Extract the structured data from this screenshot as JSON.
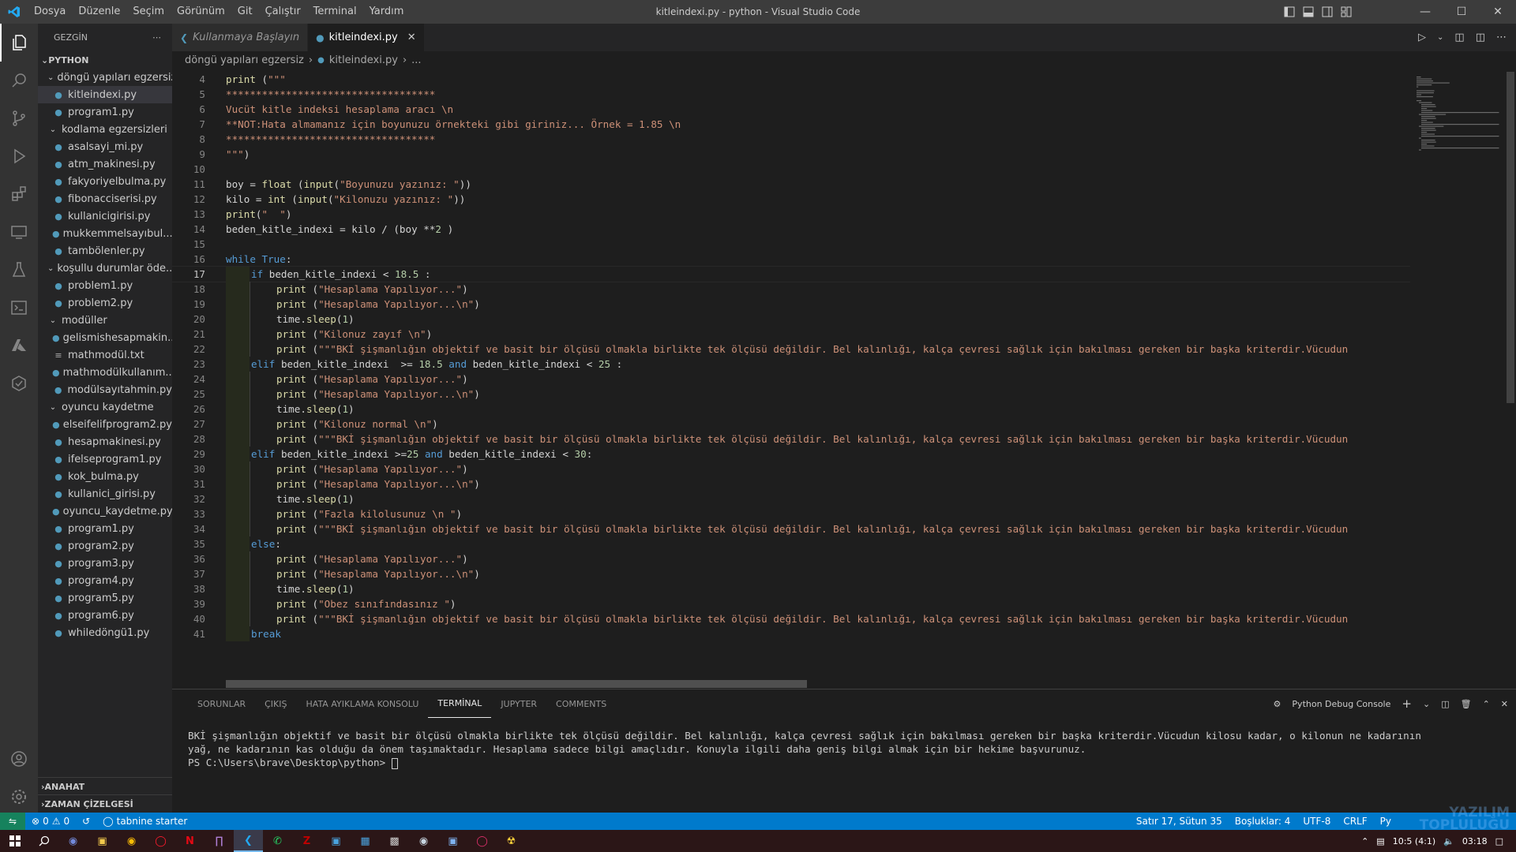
{
  "titlebar": {
    "menu": [
      "Dosya",
      "Düzenle",
      "Seçim",
      "Görünüm",
      "Git",
      "Çalıştır",
      "Terminal",
      "Yardım"
    ],
    "title": "kitleindexi.py - python - Visual Studio Code"
  },
  "sidebar": {
    "header": "GEZGİN",
    "root": "PYTHON",
    "tree": [
      {
        "type": "folder",
        "label": "döngü yapıları egzersiz",
        "depth": 1
      },
      {
        "type": "file",
        "label": "kitleindexi.py",
        "depth": 2,
        "selected": true
      },
      {
        "type": "file",
        "label": "program1.py",
        "depth": 2
      },
      {
        "type": "folder",
        "label": "kodlama egzersizleri",
        "depth": 1
      },
      {
        "type": "file",
        "label": "asalsayi_mi.py",
        "depth": 2
      },
      {
        "type": "file",
        "label": "atm_makinesi.py",
        "depth": 2
      },
      {
        "type": "file",
        "label": "fakyoriyelbulma.py",
        "depth": 2
      },
      {
        "type": "file",
        "label": "fibonacciserisi.py",
        "depth": 2
      },
      {
        "type": "file",
        "label": "kullanicigirisi.py",
        "depth": 2
      },
      {
        "type": "file",
        "label": "mukkemmelsayıbul...",
        "depth": 2
      },
      {
        "type": "file",
        "label": "tambölenler.py",
        "depth": 2
      },
      {
        "type": "folder",
        "label": "koşullu durumlar öde...",
        "depth": 1
      },
      {
        "type": "file",
        "label": "problem1.py",
        "depth": 2
      },
      {
        "type": "file",
        "label": "problem2.py",
        "depth": 2
      },
      {
        "type": "folder",
        "label": "modüller",
        "depth": 1
      },
      {
        "type": "file",
        "label": "gelismishesapmakin...",
        "depth": 2
      },
      {
        "type": "txt",
        "label": "mathmodül.txt",
        "depth": 2
      },
      {
        "type": "file",
        "label": "mathmodülkullanım....",
        "depth": 2
      },
      {
        "type": "file",
        "label": "modülsayıtahmin.py",
        "depth": 2
      },
      {
        "type": "folder",
        "label": "oyuncu kaydetme",
        "depth": 1
      },
      {
        "type": "file",
        "label": "elseifelifprogram2.py",
        "depth": 2
      },
      {
        "type": "file",
        "label": "hesapmakinesi.py",
        "depth": 2
      },
      {
        "type": "file",
        "label": "ifelseprogram1.py",
        "depth": 2
      },
      {
        "type": "file",
        "label": "kok_bulma.py",
        "depth": 2
      },
      {
        "type": "file",
        "label": "kullanici_girisi.py",
        "depth": 2
      },
      {
        "type": "file",
        "label": "oyuncu_kaydetme.py",
        "depth": 2
      },
      {
        "type": "file",
        "label": "program1.py",
        "depth": 2
      },
      {
        "type": "file",
        "label": "program2.py",
        "depth": 2
      },
      {
        "type": "file",
        "label": "program3.py",
        "depth": 2
      },
      {
        "type": "file",
        "label": "program4.py",
        "depth": 2
      },
      {
        "type": "file",
        "label": "program5.py",
        "depth": 2
      },
      {
        "type": "file",
        "label": "program6.py",
        "depth": 2
      },
      {
        "type": "file",
        "label": "whiledöngü1.py",
        "depth": 2
      }
    ],
    "outline": "ANAHAT",
    "timeline": "ZAMAN ÇİZELGESİ"
  },
  "tabs": [
    {
      "label": "Kullanmaya Başlayın",
      "active": false
    },
    {
      "label": "kitleindexi.py",
      "active": true
    }
  ],
  "breadcrumb": {
    "folder": "döngü yapıları egzersiz",
    "file": "kitleindexi.py",
    "tail": "..."
  },
  "code": {
    "current_line": 17,
    "lines": [
      {
        "n": 4,
        "indent": 0,
        "tokens": [
          [
            "fn",
            "print"
          ],
          [
            "op",
            " ("
          ],
          [
            "str",
            "\"\"\""
          ]
        ]
      },
      {
        "n": 5,
        "indent": 0,
        "tokens": [
          [
            "str",
            "***********************************"
          ]
        ]
      },
      {
        "n": 6,
        "indent": 0,
        "tokens": [
          [
            "str",
            "Vucüt kitle indeksi hesaplama aracı \\n"
          ]
        ]
      },
      {
        "n": 7,
        "indent": 0,
        "tokens": [
          [
            "str",
            "**NOT:Hata almamanız için boyunuzu örnekteki gibi giriniz... Örnek = 1.85 \\n"
          ]
        ]
      },
      {
        "n": 8,
        "indent": 0,
        "tokens": [
          [
            "str",
            "***********************************"
          ]
        ]
      },
      {
        "n": 9,
        "indent": 0,
        "tokens": [
          [
            "str",
            "\"\"\""
          ],
          [
            "op",
            ")"
          ]
        ]
      },
      {
        "n": 10,
        "indent": 0,
        "tokens": []
      },
      {
        "n": 11,
        "indent": 0,
        "tokens": [
          [
            "var",
            "boy"
          ],
          [
            "op",
            " = "
          ],
          [
            "fn",
            "float"
          ],
          [
            "op",
            " ("
          ],
          [
            "fn",
            "input"
          ],
          [
            "op",
            "("
          ],
          [
            "str",
            "\"Boyunuzu yazınız: \""
          ],
          [
            "op",
            "))"
          ]
        ]
      },
      {
        "n": 12,
        "indent": 0,
        "tokens": [
          [
            "var",
            "kilo"
          ],
          [
            "op",
            " = "
          ],
          [
            "fn",
            "int"
          ],
          [
            "op",
            " ("
          ],
          [
            "fn",
            "input"
          ],
          [
            "op",
            "("
          ],
          [
            "str",
            "\"Kilonuzu yazınız: \""
          ],
          [
            "op",
            "))"
          ]
        ]
      },
      {
        "n": 13,
        "indent": 0,
        "tokens": [
          [
            "fn",
            "print"
          ],
          [
            "op",
            "("
          ],
          [
            "str",
            "\"  \""
          ],
          [
            "op",
            ")"
          ]
        ]
      },
      {
        "n": 14,
        "indent": 0,
        "tokens": [
          [
            "var",
            "beden_kitle_indexi"
          ],
          [
            "op",
            " = "
          ],
          [
            "var",
            "kilo"
          ],
          [
            "op",
            " / ("
          ],
          [
            "var",
            "boy"
          ],
          [
            "op",
            " **"
          ],
          [
            "num",
            "2"
          ],
          [
            "op",
            " )"
          ]
        ]
      },
      {
        "n": 15,
        "indent": 0,
        "tokens": []
      },
      {
        "n": 16,
        "indent": 0,
        "tokens": [
          [
            "kw",
            "while"
          ],
          [
            "op",
            " "
          ],
          [
            "kw",
            "True"
          ],
          [
            "op",
            ":"
          ]
        ]
      },
      {
        "n": 17,
        "indent": 1,
        "tokens": [
          [
            "kw",
            "if"
          ],
          [
            "op",
            " "
          ],
          [
            "var",
            "beden_kitle_indexi"
          ],
          [
            "op",
            " < "
          ],
          [
            "num",
            "18.5"
          ],
          [
            "op",
            " :"
          ]
        ]
      },
      {
        "n": 18,
        "indent": 2,
        "tokens": [
          [
            "fn",
            "print"
          ],
          [
            "op",
            " ("
          ],
          [
            "str",
            "\"Hesaplama Yapılıyor...\""
          ],
          [
            "op",
            ")"
          ]
        ]
      },
      {
        "n": 19,
        "indent": 2,
        "tokens": [
          [
            "fn",
            "print"
          ],
          [
            "op",
            " ("
          ],
          [
            "str",
            "\"Hesaplama Yapılıyor...\\n\""
          ],
          [
            "op",
            ")"
          ]
        ]
      },
      {
        "n": 20,
        "indent": 2,
        "tokens": [
          [
            "var",
            "time"
          ],
          [
            "op",
            "."
          ],
          [
            "fn",
            "sleep"
          ],
          [
            "op",
            "("
          ],
          [
            "num",
            "1"
          ],
          [
            "op",
            ")"
          ]
        ]
      },
      {
        "n": 21,
        "indent": 2,
        "tokens": [
          [
            "fn",
            "print"
          ],
          [
            "op",
            " ("
          ],
          [
            "str",
            "\"Kilonuz zayıf \\n\""
          ],
          [
            "op",
            ")"
          ]
        ]
      },
      {
        "n": 22,
        "indent": 2,
        "tokens": [
          [
            "fn",
            "print"
          ],
          [
            "op",
            " ("
          ],
          [
            "str",
            "\"\"\"BKİ şişmanlığın objektif ve basit bir ölçüsü olmakla birlikte tek ölçüsü değildir. Bel kalınlığı, kalça çevresi sağlık için bakılması gereken bir başka kriterdir.Vücudun"
          ]
        ]
      },
      {
        "n": 23,
        "indent": 1,
        "tokens": [
          [
            "kw",
            "elif"
          ],
          [
            "op",
            " "
          ],
          [
            "var",
            "beden_kitle_indexi"
          ],
          [
            "op",
            "  >= "
          ],
          [
            "num",
            "18.5"
          ],
          [
            "op",
            " "
          ],
          [
            "kw",
            "and"
          ],
          [
            "op",
            " "
          ],
          [
            "var",
            "beden_kitle_indexi"
          ],
          [
            "op",
            " < "
          ],
          [
            "num",
            "25"
          ],
          [
            "op",
            " :"
          ]
        ]
      },
      {
        "n": 24,
        "indent": 2,
        "tokens": [
          [
            "fn",
            "print"
          ],
          [
            "op",
            " ("
          ],
          [
            "str",
            "\"Hesaplama Yapılıyor...\""
          ],
          [
            "op",
            ")"
          ]
        ]
      },
      {
        "n": 25,
        "indent": 2,
        "tokens": [
          [
            "fn",
            "print"
          ],
          [
            "op",
            " ("
          ],
          [
            "str",
            "\"Hesaplama Yapılıyor...\\n\""
          ],
          [
            "op",
            ")"
          ]
        ]
      },
      {
        "n": 26,
        "indent": 2,
        "tokens": [
          [
            "var",
            "time"
          ],
          [
            "op",
            "."
          ],
          [
            "fn",
            "sleep"
          ],
          [
            "op",
            "("
          ],
          [
            "num",
            "1"
          ],
          [
            "op",
            ")"
          ]
        ]
      },
      {
        "n": 27,
        "indent": 2,
        "tokens": [
          [
            "fn",
            "print"
          ],
          [
            "op",
            " ("
          ],
          [
            "str",
            "\"Kilonuz normal \\n\""
          ],
          [
            "op",
            ")"
          ]
        ]
      },
      {
        "n": 28,
        "indent": 2,
        "tokens": [
          [
            "fn",
            "print"
          ],
          [
            "op",
            " ("
          ],
          [
            "str",
            "\"\"\"BKİ şişmanlığın objektif ve basit bir ölçüsü olmakla birlikte tek ölçüsü değildir. Bel kalınlığı, kalça çevresi sağlık için bakılması gereken bir başka kriterdir.Vücudun"
          ]
        ]
      },
      {
        "n": 29,
        "indent": 1,
        "tokens": [
          [
            "kw",
            "elif"
          ],
          [
            "op",
            " "
          ],
          [
            "var",
            "beden_kitle_indexi"
          ],
          [
            "op",
            " >="
          ],
          [
            "num",
            "25"
          ],
          [
            "op",
            " "
          ],
          [
            "kw",
            "and"
          ],
          [
            "op",
            " "
          ],
          [
            "var",
            "beden_kitle_indexi"
          ],
          [
            "op",
            " < "
          ],
          [
            "num",
            "30"
          ],
          [
            "op",
            ":"
          ]
        ]
      },
      {
        "n": 30,
        "indent": 2,
        "tokens": [
          [
            "fn",
            "print"
          ],
          [
            "op",
            " ("
          ],
          [
            "str",
            "\"Hesaplama Yapılıyor...\""
          ],
          [
            "op",
            ")"
          ]
        ]
      },
      {
        "n": 31,
        "indent": 2,
        "tokens": [
          [
            "fn",
            "print"
          ],
          [
            "op",
            " ("
          ],
          [
            "str",
            "\"Hesaplama Yapılıyor...\\n\""
          ],
          [
            "op",
            ")"
          ]
        ]
      },
      {
        "n": 32,
        "indent": 2,
        "tokens": [
          [
            "var",
            "time"
          ],
          [
            "op",
            "."
          ],
          [
            "fn",
            "sleep"
          ],
          [
            "op",
            "("
          ],
          [
            "num",
            "1"
          ],
          [
            "op",
            ")"
          ]
        ]
      },
      {
        "n": 33,
        "indent": 2,
        "tokens": [
          [
            "fn",
            "print"
          ],
          [
            "op",
            " ("
          ],
          [
            "str",
            "\"Fazla kilolusunuz \\n \""
          ],
          [
            "op",
            ")"
          ]
        ]
      },
      {
        "n": 34,
        "indent": 2,
        "tokens": [
          [
            "fn",
            "print"
          ],
          [
            "op",
            " ("
          ],
          [
            "str",
            "\"\"\"BKİ şişmanlığın objektif ve basit bir ölçüsü olmakla birlikte tek ölçüsü değildir. Bel kalınlığı, kalça çevresi sağlık için bakılması gereken bir başka kriterdir.Vücudun"
          ]
        ]
      },
      {
        "n": 35,
        "indent": 1,
        "tokens": [
          [
            "kw",
            "else"
          ],
          [
            "op",
            ":"
          ]
        ]
      },
      {
        "n": 36,
        "indent": 2,
        "tokens": [
          [
            "fn",
            "print"
          ],
          [
            "op",
            " ("
          ],
          [
            "str",
            "\"Hesaplama Yapılıyor...\""
          ],
          [
            "op",
            ")"
          ]
        ]
      },
      {
        "n": 37,
        "indent": 2,
        "tokens": [
          [
            "fn",
            "print"
          ],
          [
            "op",
            " ("
          ],
          [
            "str",
            "\"Hesaplama Yapılıyor...\\n\""
          ],
          [
            "op",
            ")"
          ]
        ]
      },
      {
        "n": 38,
        "indent": 2,
        "tokens": [
          [
            "var",
            "time"
          ],
          [
            "op",
            "."
          ],
          [
            "fn",
            "sleep"
          ],
          [
            "op",
            "("
          ],
          [
            "num",
            "1"
          ],
          [
            "op",
            ")"
          ]
        ]
      },
      {
        "n": 39,
        "indent": 2,
        "tokens": [
          [
            "fn",
            "print"
          ],
          [
            "op",
            " ("
          ],
          [
            "str",
            "\"Obez sınıfındasınız \""
          ],
          [
            "op",
            ")"
          ]
        ]
      },
      {
        "n": 40,
        "indent": 2,
        "tokens": [
          [
            "fn",
            "print"
          ],
          [
            "op",
            " ("
          ],
          [
            "str",
            "\"\"\"BKİ şişmanlığın objektif ve basit bir ölçüsü olmakla birlikte tek ölçüsü değildir. Bel kalınlığı, kalça çevresi sağlık için bakılması gereken bir başka kriterdir.Vücudun"
          ]
        ]
      },
      {
        "n": 41,
        "indent": 1,
        "tokens": [
          [
            "kw",
            "break"
          ]
        ]
      }
    ]
  },
  "panel": {
    "tabs": [
      "SORUNLAR",
      "ÇIKIŞ",
      "HATA AYIKLAMA KONSOLU",
      "TERMİNAL",
      "JUPYTER",
      "COMMENTS"
    ],
    "active_tab": "TERMİNAL",
    "terminal_name": "Python Debug Console",
    "terminal_lines": [
      "BKİ şişmanlığın objektif ve basit bir ölçüsü olmakla birlikte tek ölçüsü değildir. Bel kalınlığı, kalça çevresi sağlık için bakılması gereken bir başka kriterdir.Vücudun kilosu kadar, o kilonun ne kadarının",
      "yağ, ne kadarının kas olduğu da önem taşımaktadır. Hesaplama sadece bilgi amaçlıdır. Konuyla ilgili daha geniş bilgi almak için bir hekime başvurunuz.",
      "PS C:\\Users\\brave\\Desktop\\python> "
    ]
  },
  "statusbar": {
    "errors": "0",
    "warnings": "0",
    "tabnine": "tabnine starter",
    "position": "Satır 17, Sütun 35",
    "spaces": "Boşluklar: 4",
    "encoding": "UTF-8",
    "eol": "CRLF",
    "language": "Py"
  },
  "taskbar": {
    "time": "03:18",
    "tray_text": "10:5 (4:1)"
  },
  "watermark": "YAZILIM TOPLULUĞU",
  "colors": {
    "statusbar": "#007acc",
    "activitybar": "#333333",
    "sidebar": "#252526",
    "editor": "#1e1e1e"
  }
}
